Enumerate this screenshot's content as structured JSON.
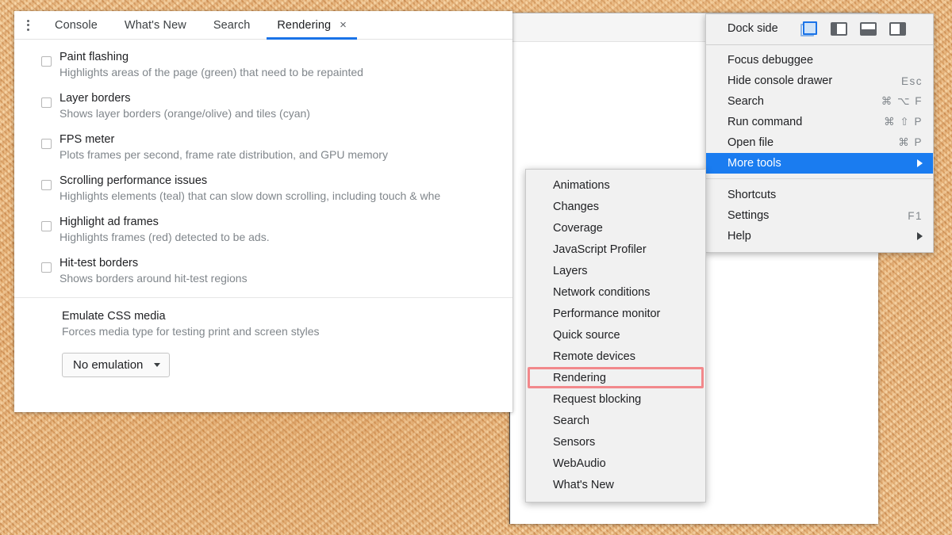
{
  "background": {
    "name": "cork-board-texture",
    "base_color": "#e8b882"
  },
  "drawer": {
    "kebab_icon": "more-vertical-icon",
    "tabs": [
      {
        "label": "Console",
        "active": false
      },
      {
        "label": "What's New",
        "active": false
      },
      {
        "label": "Search",
        "active": false
      },
      {
        "label": "Rendering",
        "active": true,
        "close_icon": "×"
      }
    ],
    "accent_color": "#1a73e8",
    "options": [
      {
        "title": "Paint flashing",
        "desc": "Highlights areas of the page (green) that need to be repainted",
        "checked": false
      },
      {
        "title": "Layer borders",
        "desc": "Shows layer borders (orange/olive) and tiles (cyan)",
        "checked": false
      },
      {
        "title": "FPS meter",
        "desc": "Plots frames per second, frame rate distribution, and GPU memory",
        "checked": false
      },
      {
        "title": "Scrolling performance issues",
        "desc": "Highlights elements (teal) that can slow down scrolling, including touch & whe",
        "checked": false
      },
      {
        "title": "Highlight ad frames",
        "desc": "Highlights frames (red) detected to be ads.",
        "checked": false
      },
      {
        "title": "Hit-test borders",
        "desc": "Shows borders around hit-test regions",
        "checked": false
      }
    ],
    "emulate": {
      "title": "Emulate CSS media",
      "desc": "Forces media type for testing print and screen styles",
      "select_value": "No emulation",
      "caret_icon": "chevron-down-icon"
    }
  },
  "main_menu": {
    "dock": {
      "label": "Dock side",
      "icons": [
        {
          "name": "undock-into-separate-window-icon",
          "active": true
        },
        {
          "name": "dock-to-left-icon",
          "active": false
        },
        {
          "name": "dock-to-bottom-icon",
          "active": false
        },
        {
          "name": "dock-to-right-icon",
          "active": false
        }
      ],
      "active_color": "#1a73e8"
    },
    "items": [
      {
        "label": "Focus debuggee",
        "accel": "",
        "arrow": false,
        "selected": false
      },
      {
        "label": "Hide console drawer",
        "accel": "Esc",
        "arrow": false,
        "selected": false
      },
      {
        "label": "Search",
        "accel": "⌘ ⌥ F",
        "arrow": false,
        "selected": false
      },
      {
        "label": "Run command",
        "accel": "⌘ ⇧ P",
        "arrow": false,
        "selected": false
      },
      {
        "label": "Open file",
        "accel": "⌘ P",
        "arrow": false,
        "selected": false
      },
      {
        "label": "More tools",
        "accel": "",
        "arrow": true,
        "selected": true
      }
    ],
    "items_after": [
      {
        "label": "Shortcuts",
        "accel": "",
        "arrow": false,
        "selected": false
      },
      {
        "label": "Settings",
        "accel": "F1",
        "arrow": false,
        "selected": false
      },
      {
        "label": "Help",
        "accel": "",
        "arrow": true,
        "selected": false
      }
    ],
    "selected_color": "#1a7cf0"
  },
  "submenu": {
    "highlight_color": "#f2888b",
    "items": [
      {
        "label": "Animations",
        "highlighted": false
      },
      {
        "label": "Changes",
        "highlighted": false
      },
      {
        "label": "Coverage",
        "highlighted": false
      },
      {
        "label": "JavaScript Profiler",
        "highlighted": false
      },
      {
        "label": "Layers",
        "highlighted": false
      },
      {
        "label": "Network conditions",
        "highlighted": false
      },
      {
        "label": "Performance monitor",
        "highlighted": false
      },
      {
        "label": "Quick source",
        "highlighted": false
      },
      {
        "label": "Remote devices",
        "highlighted": false
      },
      {
        "label": "Rendering",
        "highlighted": true
      },
      {
        "label": "Request blocking",
        "highlighted": false
      },
      {
        "label": "Search",
        "highlighted": false
      },
      {
        "label": "Sensors",
        "highlighted": false
      },
      {
        "label": "WebAudio",
        "highlighted": false
      },
      {
        "label": "What's New",
        "highlighted": false
      }
    ]
  }
}
